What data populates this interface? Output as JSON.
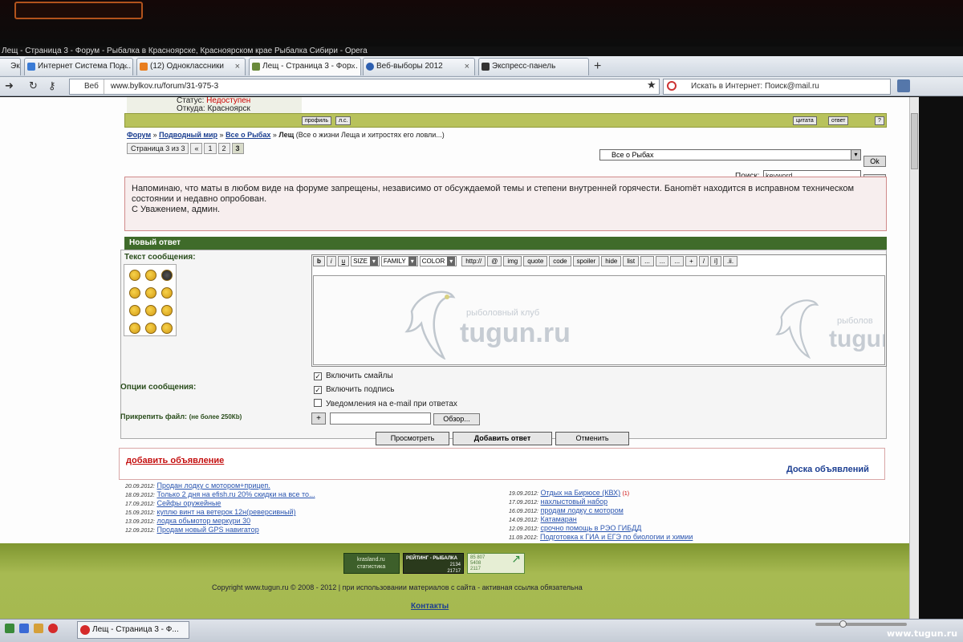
{
  "window": {
    "title": "Лещ - Страница 3 - Форум - Рыбалка в Красноярске, Красноярском крае Рыбалка Сибири - Opera"
  },
  "tabs": [
    {
      "label": "Экспрес"
    },
    {
      "label": "Интернет Система Под..."
    },
    {
      "label": "(12) Одноклассники"
    },
    {
      "label": "Лещ - Страница 3 - Фор..."
    },
    {
      "label": "Веб-выборы 2012"
    },
    {
      "label": "Экспресс-панель"
    }
  ],
  "nav": {
    "site_label": "Веб",
    "url": "www.bylkov.ru/forum/31-975-3",
    "search_text": "Искать в Интернет: Поиск@mail.ru"
  },
  "profile": {
    "status_label": "Статус:",
    "status_value": "Недоступен",
    "from_label": "Откуда:",
    "from_value": "Красноярск",
    "btn_profile": "профиль",
    "btn_pm": "л.с.",
    "btn_quote": "цитата",
    "btn_reply": "ответ",
    "btn_help": "?"
  },
  "breadcrumb": {
    "forum": "Форум",
    "sep": " » ",
    "section": "Подводный мир",
    "subsection": "Все о Рыбах",
    "topic": "Лещ",
    "topic_desc": "(Все о жизни Леща и хитростях его ловли...)"
  },
  "pager": {
    "label": "Страница 3 из 3",
    "prev": "«",
    "pages": [
      "1",
      "2",
      "3"
    ]
  },
  "jump": {
    "selected": "Все о Рыбах",
    "ok": "Ok"
  },
  "search": {
    "label": "Поиск:",
    "value": "keyword",
    "ok": "Ok"
  },
  "notice": {
    "line1": "Напоминаю, что маты в любом виде на форуме запрещены, независимо от обсуждаемой темы и степени внутренней горячести. Банomёт находится в исправном техническом состоянии и недавно опробован.",
    "line2": "С Уважением, админ."
  },
  "reply": {
    "header": "Новый ответ",
    "msg_label": "Текст сообщения:",
    "toolbar": [
      "b",
      "i",
      "u",
      "SIZE",
      "FAMILY",
      "COLOR",
      "http://",
      "@",
      "img",
      "quote",
      "code",
      "spoiler",
      "hide",
      "list",
      "...",
      "...",
      "...",
      "+",
      "/",
      "i]",
      ".ii."
    ],
    "watermark_main": "tugun.ru",
    "watermark_sub": "рыболовный клуб",
    "watermark_right": "tugun",
    "watermark_right_sub": "рыболов",
    "options_label": "Опции сообщения:",
    "opt_smiles": "Включить смайлы",
    "opt_signature": "Включить подпись",
    "opt_email": "Уведомления на e-mail при ответах",
    "attach_label": "Прикрепить файл:",
    "attach_limit": "(не более 250Кb)",
    "plus": "+",
    "browse": "Обзор...",
    "btn_preview": "Просмотреть",
    "btn_submit": "Добавить ответ",
    "btn_cancel": "Отменить"
  },
  "ads": {
    "add": "добавить объявление",
    "board": "Доска объявлений",
    "left": [
      {
        "date": "20.09.2012:",
        "text": "Продан лодку с мотором+прицеп."
      },
      {
        "date": "18.09.2012:",
        "text": "Только 2 дня на efish.ru 20% скидки на все то..."
      },
      {
        "date": "17.09.2012:",
        "text": "Сейфы оружейные"
      },
      {
        "date": "15.09.2012:",
        "text": "куплю винт на ветерок 12н(реверсивный)"
      },
      {
        "date": "13.09.2012:",
        "text": "лодка обьмотор меркури 30"
      },
      {
        "date": "12.09.2012:",
        "text": "Продам новый GPS навигатор"
      }
    ],
    "right": [
      {
        "date": "19.09.2012:",
        "text": "Отдых на Бирюсе (КВХ)",
        "count": "(1)"
      },
      {
        "date": "17.09.2012:",
        "text": "нахлыстовый набор"
      },
      {
        "date": "16.09.2012:",
        "text": "продам лодку с мотором"
      },
      {
        "date": "14.09.2012:",
        "text": "Катамаран"
      },
      {
        "date": "12.09.2012:",
        "text": "срочно помощь в РЭО ГИБДД"
      },
      {
        "date": "11.09.2012:",
        "text": "Подготовка к ГИА и ЕГЭ по биологии и химии"
      }
    ]
  },
  "footer": {
    "badge1": "krasland.ru статистика",
    "badge2_title": "РЕЙТИНГ - РЫБАЛКА",
    "badge2_n1": "2134",
    "badge2_n2": "21717",
    "badge3_n1": "85 807",
    "badge3_n2": "5408",
    "badge3_n3": "2117",
    "copyright": "Copyright www.tugun.ru © 2008 - 2012 | при использовании материалов с сайта - активная ссылка обязательна",
    "contacts": "Контакты"
  },
  "taskbar": {
    "item": "Лещ - Страница 3 - Ф..."
  },
  "site_watermark": "www.tugun.ru",
  "colors": {
    "forum_green": "#3f6b2a",
    "footer_green": "#9eb048",
    "link_blue": "#2a55b0",
    "alert_red": "#c41010"
  }
}
